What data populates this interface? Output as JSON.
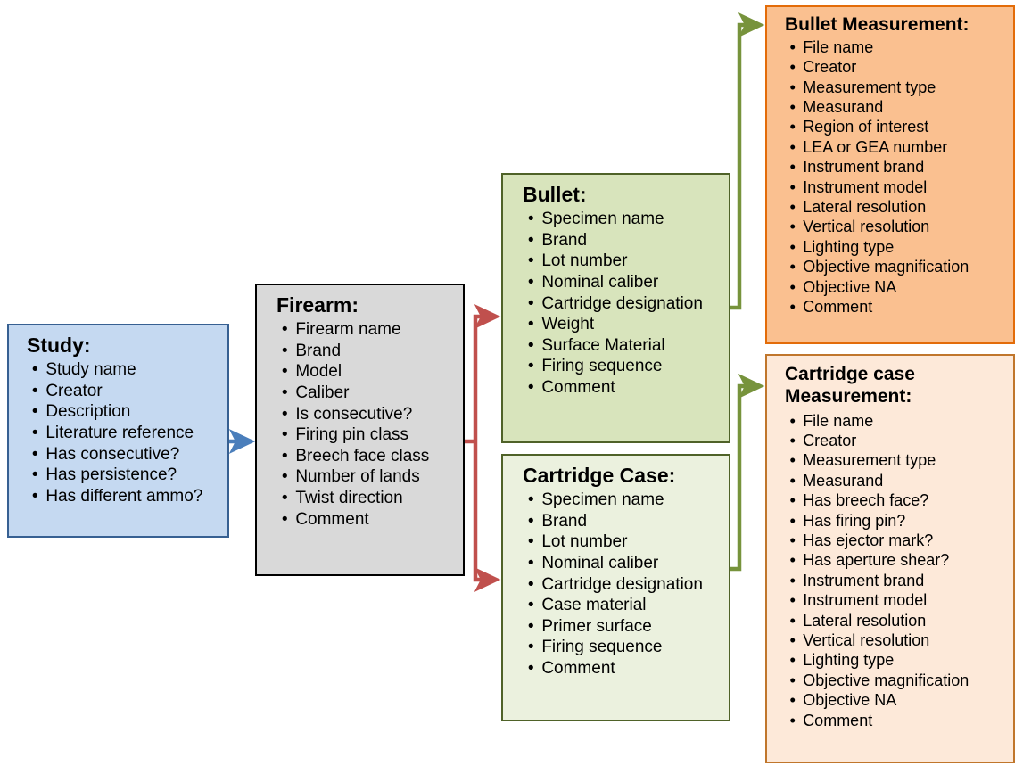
{
  "diagram": {
    "title": "Firearm toolmark study data model",
    "colors": {
      "study_fill": "#c5d9f1",
      "study_border": "#376092",
      "firearm_fill": "#d9d9d9",
      "firearm_border": "#000000",
      "bullet_fill": "#d8e4bc",
      "bullet_border": "#4f6228",
      "cartridge_case_fill": "#ebf1de",
      "cartridge_case_border": "#4f6228",
      "bullet_measurement_fill": "#fac090",
      "bullet_measurement_border": "#e36c09",
      "cc_measurement_fill": "#fde9d9",
      "cc_measurement_border": "#c0762c",
      "arrow_blue": "#4a7ebb",
      "arrow_red": "#c0504d",
      "arrow_green": "#77933c"
    }
  },
  "study": {
    "title": "Study:",
    "fields": [
      "Study name",
      "Creator",
      "Description",
      "Literature reference",
      "Has consecutive?",
      "Has persistence?",
      "Has different ammo?"
    ]
  },
  "firearm": {
    "title": "Firearm:",
    "fields": [
      "Firearm name",
      "Brand",
      "Model",
      "Caliber",
      "Is consecutive?",
      "Firing pin class",
      "Breech face class",
      "Number of lands",
      "Twist direction",
      "Comment"
    ]
  },
  "bullet": {
    "title": "Bullet:",
    "fields": [
      "Specimen name",
      "Brand",
      "Lot number",
      "Nominal caliber",
      "Cartridge designation",
      "Weight",
      "Surface Material",
      "Firing sequence",
      "Comment"
    ]
  },
  "cartridge_case": {
    "title": "Cartridge Case:",
    "fields": [
      "Specimen name",
      "Brand",
      "Lot number",
      "Nominal caliber",
      "Cartridge designation",
      "Case material",
      "Primer surface",
      "Firing sequence",
      "Comment"
    ]
  },
  "bullet_measurement": {
    "title": "Bullet Measurement:",
    "fields": [
      "File name",
      "Creator",
      "Measurement type",
      "Measurand",
      "Region of interest",
      "LEA or GEA number",
      "Instrument brand",
      "Instrument model",
      "Lateral resolution",
      "Vertical resolution",
      "Lighting type",
      "Objective magnification",
      "Objective NA",
      "Comment"
    ]
  },
  "cc_measurement": {
    "title": "Cartridge case\nMeasurement:",
    "fields": [
      "File name",
      "Creator",
      "Measurement type",
      "Measurand",
      "Has breech face?",
      "Has firing pin?",
      "Has ejector mark?",
      "Has aperture shear?",
      "Instrument brand",
      "Instrument model",
      "Lateral resolution",
      "Vertical resolution",
      "Lighting type",
      "Objective magnification",
      "Objective NA",
      "Comment"
    ]
  },
  "connectors": [
    {
      "name": "study-to-firearm",
      "color": "#4a7ebb"
    },
    {
      "name": "firearm-to-bullet",
      "color": "#c0504d"
    },
    {
      "name": "firearm-to-cartridge-case",
      "color": "#c0504d"
    },
    {
      "name": "bullet-to-bullet-measurement",
      "color": "#77933c"
    },
    {
      "name": "cartridge-case-to-cc-measurement",
      "color": "#77933c"
    }
  ]
}
